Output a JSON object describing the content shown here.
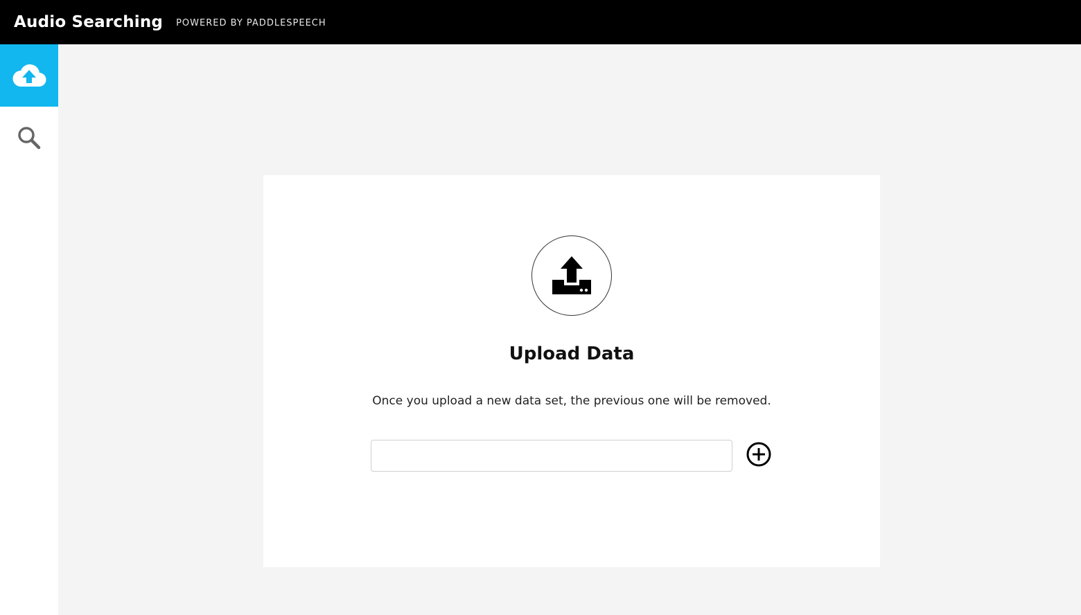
{
  "header": {
    "title": "Audio Searching",
    "subtitle": "POWERED BY PADDLESPEECH"
  },
  "sidebar": {
    "items": [
      {
        "name": "upload",
        "icon": "cloud-upload-icon",
        "active": true
      },
      {
        "name": "search",
        "icon": "search-icon",
        "active": false
      }
    ]
  },
  "card": {
    "icon": "upload-icon",
    "title": "Upload Data",
    "description": "Once you upload a new data set, the previous one will be removed.",
    "input_value": "",
    "input_placeholder": "",
    "add_icon": "plus-circle-icon"
  },
  "colors": {
    "header_bg": "#000000",
    "accent": "#12b7ef",
    "page_bg": "#f4f4f4",
    "card_bg": "#ffffff"
  }
}
